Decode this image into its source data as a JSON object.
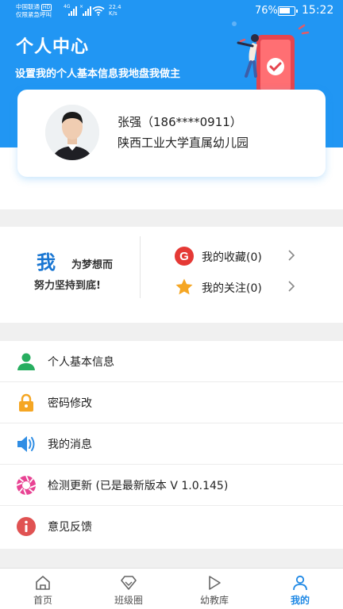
{
  "status_bar": {
    "carrier": "中国联通",
    "carrier_tag": "HD",
    "carrier_sub": "仅限紧急呼叫",
    "network_labels": [
      "4G",
      "×"
    ],
    "net_speed_value": "22.4",
    "net_speed_unit": "K/s",
    "battery_text": "76%",
    "battery_level": 0.76,
    "time": "15:22"
  },
  "hero": {
    "title": "个人中心",
    "subtitle": "设置我的个人基本信息我地盘我做主"
  },
  "profile": {
    "name_phone": "张强（186****0911）",
    "organization": "陕西工业大学直属幼儿园"
  },
  "motto": {
    "big_char": "我",
    "line1": "为梦想而",
    "line2": "努力坚持到底!"
  },
  "quick_links": [
    {
      "label": "我的收藏(0)",
      "icon": "google-g-icon"
    },
    {
      "label": "我的关注(0)",
      "icon": "star-icon"
    }
  ],
  "menu": [
    {
      "label": "个人基本信息",
      "icon": "person-icon"
    },
    {
      "label": "密码修改",
      "icon": "lock-icon"
    },
    {
      "label": "我的消息",
      "icon": "speaker-icon"
    },
    {
      "label": "检测更新 (已是最新版本 V 1.0.145)",
      "icon": "aperture-icon"
    },
    {
      "label": "意见反馈",
      "icon": "info-icon"
    }
  ],
  "tabs": [
    {
      "label": "首页",
      "icon": "home-icon",
      "active": false
    },
    {
      "label": "班级圈",
      "icon": "diamond-icon",
      "active": false
    },
    {
      "label": "幼教库",
      "icon": "play-icon",
      "active": false
    },
    {
      "label": "我的",
      "icon": "user-icon",
      "active": true
    }
  ],
  "colors": {
    "header_blue": "#2196f3",
    "accent_blue": "#1e88e5",
    "motto_blue": "#1976d2",
    "person_green": "#27ae60",
    "lock_orange": "#f5a623",
    "speaker_blue": "#2f8de4",
    "aperture_pink": "#e84393",
    "info_red": "#e05252",
    "google_red": "#e53935",
    "star_orange": "#f5a623"
  }
}
